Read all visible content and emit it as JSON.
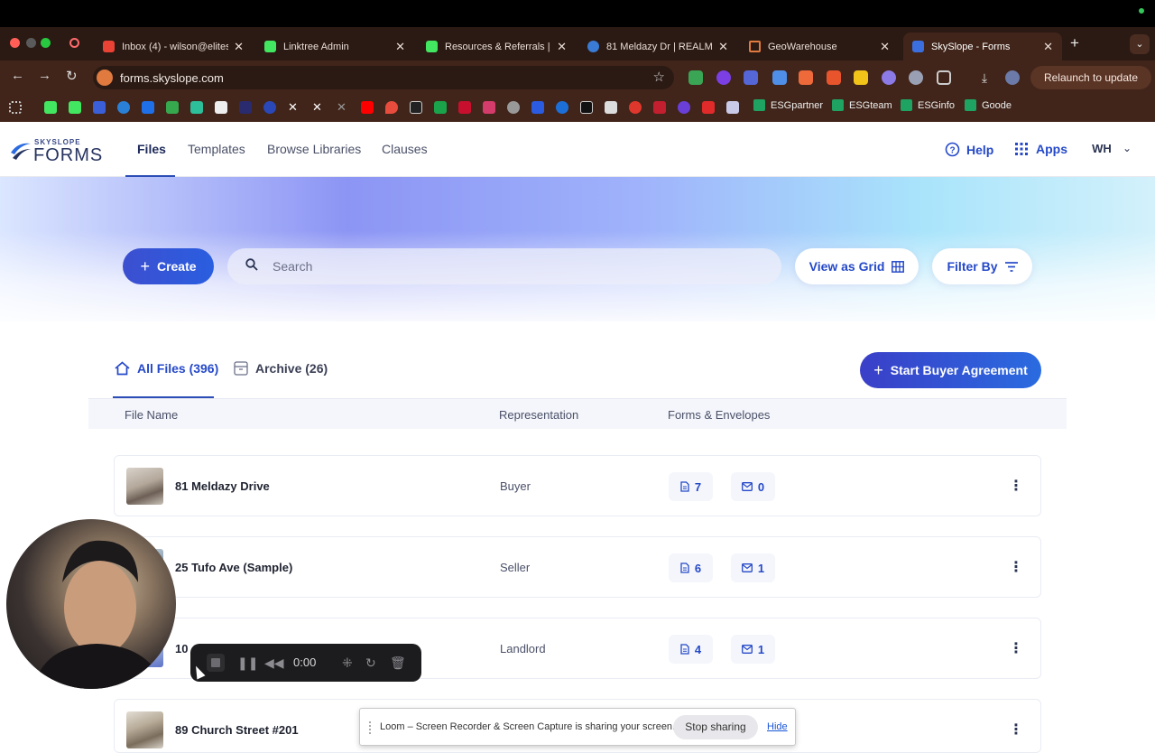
{
  "browser": {
    "tabs": [
      {
        "title": "Inbox (4) - wilson@elites",
        "favicon_color": "#ea4335"
      },
      {
        "title": "Linktree Admin",
        "favicon_color": "#43e660"
      },
      {
        "title": "Resources & Referrals | E",
        "favicon_color": "#43e660"
      },
      {
        "title": "81 Meldazy Dr | REALM",
        "favicon_color": "#3a7bd5"
      },
      {
        "title": "GeoWarehouse",
        "favicon_color": "#e07a3f"
      },
      {
        "title": "SkySlope - Forms",
        "favicon_color": "#3b6fe0"
      }
    ],
    "url": "forms.skyslope.com",
    "relaunch_label": "Relaunch to update",
    "bookmarks": [
      "ESGpartner",
      "ESGteam",
      "ESGinfo",
      "Goode"
    ]
  },
  "app": {
    "logo_small": "SKYSLOPE",
    "logo_big": "FORMS",
    "nav": [
      "Files",
      "Templates",
      "Browse Libraries",
      "Clauses"
    ],
    "help_label": "Help",
    "apps_label": "Apps",
    "user_initials": "WH"
  },
  "toolbar": {
    "create_label": "Create",
    "search_placeholder": "Search",
    "view_grid_label": "View as Grid",
    "filter_label": "Filter By"
  },
  "file_tabs": {
    "all_files": "All Files (396)",
    "archive": "Archive (26)",
    "start_buyer_agreement": "Start Buyer Agreement"
  },
  "columns": [
    "File Name",
    "Representation",
    "Forms & Envelopes"
  ],
  "rows": [
    {
      "name": "81 Meldazy Drive",
      "representation": "Buyer",
      "forms": "7",
      "envelopes": "0"
    },
    {
      "name": "25 Tufo Ave (Sample)",
      "representation": "Seller",
      "forms": "6",
      "envelopes": "1"
    },
    {
      "name": "10 ",
      "representation": "Landlord",
      "forms": "4",
      "envelopes": "1"
    },
    {
      "name": "89 Church Street #201",
      "representation": "",
      "forms": "",
      "envelopes": ""
    }
  ],
  "recorder": {
    "time": "0:00"
  },
  "loom": {
    "message": "Loom – Screen Recorder & Screen Capture is sharing your screen.",
    "stop_label": "Stop sharing",
    "hide_label": "Hide"
  },
  "colors": {
    "accent": "#2549c8",
    "header_bg": "#41251a"
  }
}
